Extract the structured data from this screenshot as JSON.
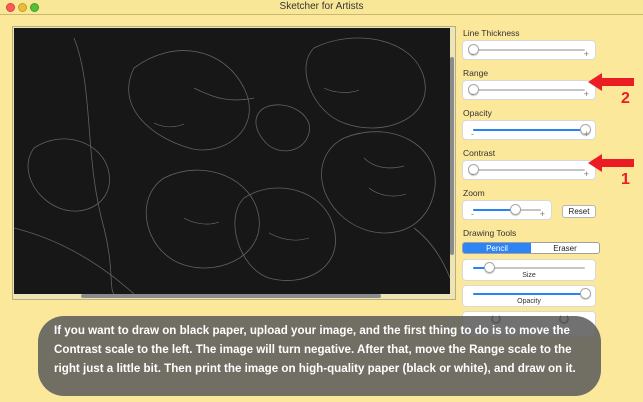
{
  "window": {
    "title": "Sketcher for Artists"
  },
  "panel": {
    "line_thickness_label": "Line Thickness",
    "range_label": "Range",
    "opacity_label": "Opacity",
    "contrast_label": "Contrast",
    "zoom_label": "Zoom",
    "reset_label": "Reset",
    "drawing_tools_label": "Drawing Tools",
    "pencil_label": "Pencil",
    "eraser_label": "Eraser",
    "size_label": "Size",
    "brush_opacity_label": "Opacity",
    "minus": "-",
    "plus": "+"
  },
  "sliders": {
    "line_thickness": 0.0,
    "range": 0.0,
    "opacity": 1.0,
    "contrast": 0.0,
    "zoom": 0.62,
    "size": 0.15,
    "brush_opacity": 1.0
  },
  "annotations": {
    "arrow_range_number": "2",
    "arrow_contrast_number": "1",
    "arrow_color": "#ec1c24"
  },
  "caption": "If you want to draw on black paper, upload your image, and the first thing to do is to move the Contrast scale to the left. The image will turn negative. After that, move the Range scale to the right just a little bit. Then print the image on high-quality paper (black or white), and draw on it.",
  "colors": {
    "background": "#fce89a",
    "accent": "#2d84f5",
    "canvas": "#171717"
  }
}
